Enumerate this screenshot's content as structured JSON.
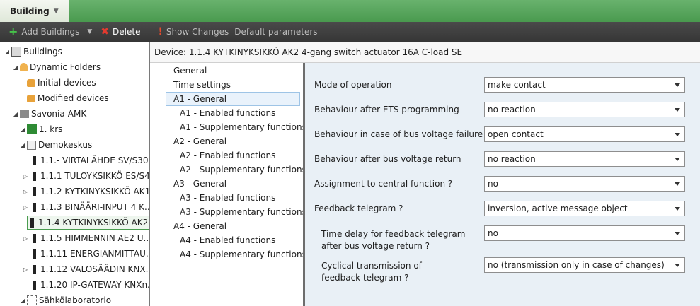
{
  "app": {
    "title": "Building"
  },
  "toolbar": {
    "add_buildings": "Add Buildings",
    "delete": "Delete",
    "show_changes": "Show Changes",
    "default_parameters": "Default parameters"
  },
  "tree": [
    {
      "label": "Buildings",
      "icon": "buildings-icon",
      "exp": "open"
    },
    {
      "label": "Dynamic Folders",
      "icon": "dynamic-folder-icon",
      "exp": "open"
    },
    {
      "label": "Initial devices",
      "icon": "folder-icon",
      "exp": ""
    },
    {
      "label": "Modified devices",
      "icon": "folder-icon",
      "exp": ""
    },
    {
      "label": "Savonia-AMK",
      "icon": "building-icon",
      "exp": "open"
    },
    {
      "label": "1. krs",
      "icon": "floor-icon",
      "exp": "open"
    },
    {
      "label": "Demokeskus",
      "icon": "room-icon",
      "exp": "open"
    },
    {
      "label": "1.1.- VIRTALÄHDE SV/S30...",
      "icon": "device-icon",
      "exp": ""
    },
    {
      "label": "1.1.1 TULOYKSIKKÖ ES/S4...",
      "icon": "device-icon",
      "exp": "closed"
    },
    {
      "label": "1.1.2 KYTKINYKSIKKÖ AK1...",
      "icon": "device-icon",
      "exp": "closed"
    },
    {
      "label": "1.1.3 BINÄÄRI-INPUT 4 K...",
      "icon": "device-icon",
      "exp": "closed"
    },
    {
      "label": "1.1.4 KYTKINYKSIKKÖ AK2...",
      "icon": "device-icon",
      "exp": "closed",
      "selected": true
    },
    {
      "label": "1.1.5 HIMMENNIN AE2 U...",
      "icon": "device-icon",
      "exp": "closed"
    },
    {
      "label": "1.1.11 ENERGIANMITTAU...",
      "icon": "device-icon",
      "exp": ""
    },
    {
      "label": "1.1.12 VALOSÄÄDIN KNX...",
      "icon": "device-icon",
      "exp": "closed"
    },
    {
      "label": "1.1.20 IP-GATEWAY KNXn...",
      "icon": "device-icon",
      "exp": ""
    },
    {
      "label": "Sähkölaboratorio",
      "icon": "lab-icon",
      "exp": "open"
    }
  ],
  "device": {
    "header": "Device: 1.1.4 KYTKINYKSIKKÖ AK2 4-gang switch actuator 16A C-load SE"
  },
  "param_nav": [
    {
      "label": "General",
      "level": 0
    },
    {
      "label": "Time settings",
      "level": 0
    },
    {
      "label": "A1 - General",
      "level": 0,
      "selected": true
    },
    {
      "label": "A1 - Enabled functions",
      "level": 1
    },
    {
      "label": "A1 - Supplementary functions",
      "level": 1
    },
    {
      "label": "A2 - General",
      "level": 0
    },
    {
      "label": "A2 - Enabled functions",
      "level": 1
    },
    {
      "label": "A2 - Supplementary functions",
      "level": 1
    },
    {
      "label": "A3 - General",
      "level": 0
    },
    {
      "label": "A3 - Enabled functions",
      "level": 1
    },
    {
      "label": "A3 - Supplementary functions",
      "level": 1
    },
    {
      "label": "A4 - General",
      "level": 0
    },
    {
      "label": "A4 - Enabled functions",
      "level": 1
    },
    {
      "label": "A4 - Supplementary functions",
      "level": 1
    }
  ],
  "params": [
    {
      "label": "Mode of operation",
      "value": "make contact"
    },
    {
      "label": "Behaviour after ETS programming",
      "value": "no reaction"
    },
    {
      "label": "Behaviour in case of bus voltage failure",
      "value": "open contact"
    },
    {
      "label": "Behaviour after bus voltage return",
      "value": "no reaction"
    },
    {
      "label": "Assignment to central function ?",
      "value": "no"
    },
    {
      "label": "Feedback telegram ?",
      "value": "inversion, active message object"
    },
    {
      "label": "Time delay for feedback telegram\nafter bus voltage return ?",
      "value": "no",
      "indent": true
    },
    {
      "label": "Cyclical transmission of\nfeedback telegram ?",
      "value": "no (transmission only in case of changes)",
      "indent": true
    }
  ]
}
